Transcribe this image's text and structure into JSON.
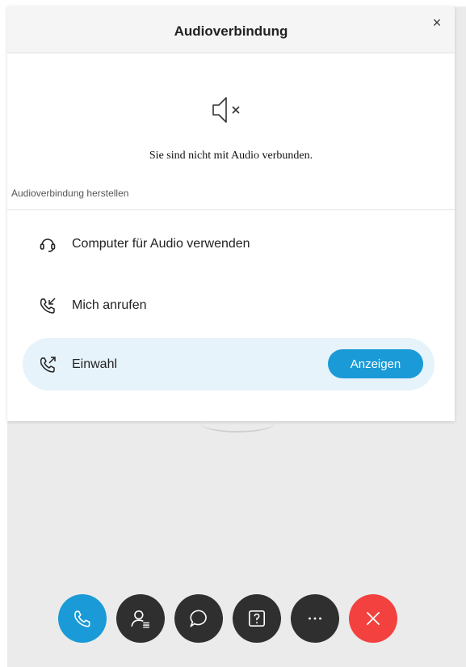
{
  "dialog": {
    "title": "Audioverbindung",
    "close_label": "×",
    "status_text": "Sie sind nicht mit Audio verbunden.",
    "section_label": "Audioverbindung herstellen",
    "options": [
      {
        "label": "Computer für Audio verwenden",
        "icon": "headset-icon"
      },
      {
        "label": "Mich anrufen",
        "icon": "incoming-call-icon"
      },
      {
        "label": "Einwahl",
        "icon": "outgoing-call-icon",
        "action_label": "Anzeigen"
      }
    ]
  },
  "controls": [
    {
      "icon": "phone-icon",
      "color": "#1a9ad7"
    },
    {
      "icon": "participants-icon",
      "color": "#2f2f2f"
    },
    {
      "icon": "chat-icon",
      "color": "#2f2f2f"
    },
    {
      "icon": "question-icon",
      "color": "#2f2f2f"
    },
    {
      "icon": "more-icon",
      "color": "#2f2f2f"
    },
    {
      "icon": "leave-icon",
      "color": "#f2413f"
    }
  ],
  "colors": {
    "accent": "#1a9ad7",
    "selected_bg": "#e6f3fb",
    "danger": "#f2413f"
  }
}
